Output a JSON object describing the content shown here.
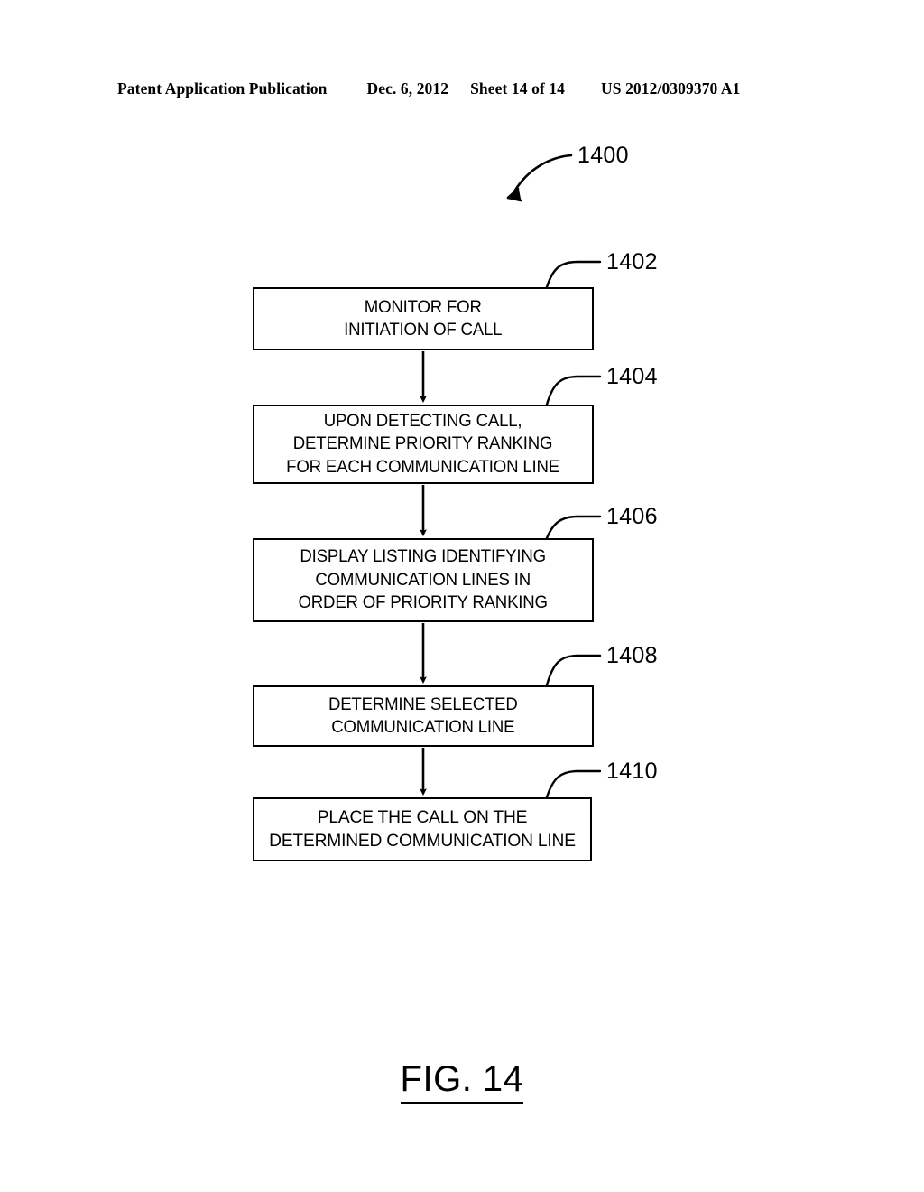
{
  "header": {
    "publication": "Patent Application Publication",
    "date": "Dec. 6, 2012",
    "sheet": "Sheet 14 of 14",
    "document_number": "US 2012/0309370 A1"
  },
  "figure": {
    "caption": "FIG. 14",
    "diagram_label": "1400"
  },
  "flowchart": {
    "type": "flowchart",
    "orientation": "vertical",
    "steps": [
      {
        "ref": "1402",
        "text": "MONITOR FOR\nINITIATION OF CALL",
        "lines": [
          "MONITOR FOR",
          "INITIATION OF CALL"
        ]
      },
      {
        "ref": "1404",
        "text": "UPON DETECTING CALL,\nDETERMINE PRIORITY RANKING\nFOR EACH COMMUNICATION LINE",
        "lines": [
          "UPON DETECTING CALL,",
          "DETERMINE PRIORITY RANKING",
          "FOR EACH COMMUNICATION LINE"
        ]
      },
      {
        "ref": "1406",
        "text": "DISPLAY LISTING IDENTIFYING\nCOMMUNICATION LINES IN\nORDER OF PRIORITY RANKING",
        "lines": [
          "DISPLAY LISTING IDENTIFYING",
          "COMMUNICATION LINES IN",
          "ORDER OF PRIORITY RANKING"
        ]
      },
      {
        "ref": "1408",
        "text": "DETERMINE SELECTED\nCOMMUNICATION LINE",
        "lines": [
          "DETERMINE SELECTED",
          "COMMUNICATION LINE"
        ]
      },
      {
        "ref": "1410",
        "text": "PLACE THE CALL ON THE\nDETERMINED COMMUNICATION LINE",
        "lines": [
          "PLACE THE CALL ON THE",
          "DETERMINED COMMUNICATION LINE"
        ]
      }
    ],
    "connectors": [
      {
        "from": "1402",
        "to": "1404",
        "style": "arrow-down"
      },
      {
        "from": "1404",
        "to": "1406",
        "style": "arrow-down"
      },
      {
        "from": "1406",
        "to": "1408",
        "style": "arrow-down"
      },
      {
        "from": "1408",
        "to": "1410",
        "style": "arrow-down"
      }
    ],
    "colors": {
      "ink": "#000000",
      "paper": "#ffffff"
    }
  }
}
